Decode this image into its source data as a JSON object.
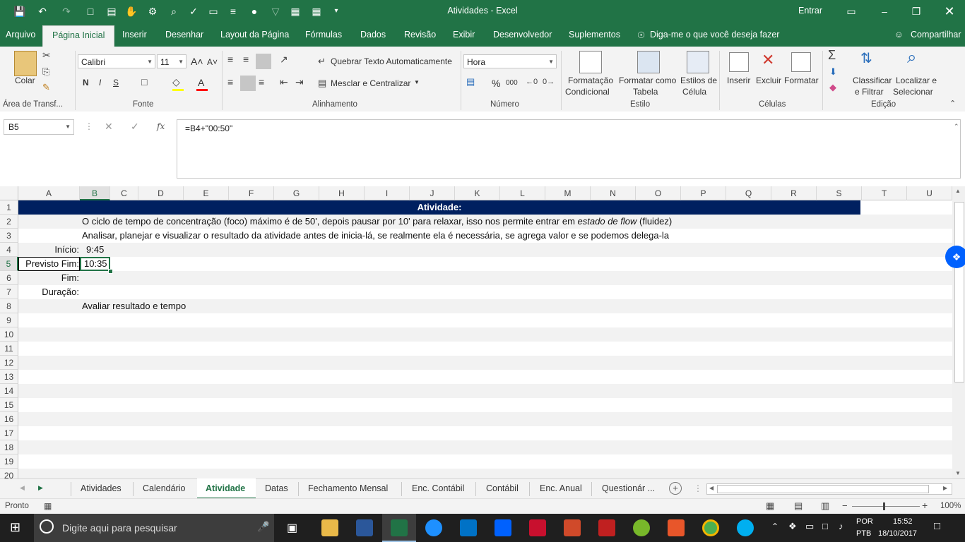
{
  "titlebar": {
    "title": "Atividades  -  Excel",
    "signin": "Entrar"
  },
  "ribbon_tabs": [
    "Arquivo",
    "Página Inicial",
    "Inserir",
    "Desenhar",
    "Layout da Página",
    "Fórmulas",
    "Dados",
    "Revisão",
    "Exibir",
    "Desenvolvedor",
    "Suplementos"
  ],
  "tell_me": "Diga-me o que você deseja fazer",
  "share": "Compartilhar",
  "ribbon": {
    "clipboard": {
      "paste": "Colar",
      "label": "Área de Transf..."
    },
    "font": {
      "name": "Calibri",
      "size": "11",
      "label": "Fonte",
      "bold": "N",
      "italic": "I",
      "underline": "S"
    },
    "alignment": {
      "wrap": "Quebrar Texto Automaticamente",
      "merge": "Mesclar e Centralizar",
      "label": "Alinhamento"
    },
    "number": {
      "format": "Hora",
      "label": "Número",
      "percent": "%",
      "thousands": "000"
    },
    "styles": {
      "conditional": [
        "Formatação",
        "Condicional"
      ],
      "table": [
        "Formatar como",
        "Tabela"
      ],
      "cell": [
        "Estilos de",
        "Célula"
      ],
      "label": "Estilo"
    },
    "cells": {
      "insert": "Inserir",
      "delete": "Excluir",
      "format": "Formatar",
      "label": "Células"
    },
    "editing": {
      "sort": [
        "Classificar",
        "e Filtrar"
      ],
      "find": [
        "Localizar e",
        "Selecionar"
      ],
      "label": "Edição"
    }
  },
  "formula_bar": {
    "name_box": "B5",
    "fx": "fx",
    "formula": "=B4+\"00:50\""
  },
  "columns": [
    "A",
    "B",
    "C",
    "D",
    "E",
    "F",
    "G",
    "H",
    "I",
    "J",
    "K",
    "L",
    "M",
    "N",
    "O",
    "P",
    "Q",
    "R",
    "S",
    "T",
    "U"
  ],
  "rows": [
    "1",
    "2",
    "3",
    "4",
    "5",
    "6",
    "7",
    "8",
    "9",
    "10",
    "11",
    "12",
    "13",
    "14",
    "15",
    "16",
    "17",
    "18",
    "19",
    "20"
  ],
  "cells": {
    "r1_title": "Atividade:",
    "r2_text_a": "O ciclo de tempo de concentração (foco) máximo é de 50', depois pausar por 10' para relaxar, isso nos permite entrar em ",
    "r2_text_b": "estado de flow",
    "r2_text_c": "  (fluidez)",
    "r3_text": "Analisar, planejar e visualizar o resultado da atividade antes de inicia-lá, se realmente ela é necessária, se agrega valor e se podemos delega-la",
    "r4_label": "Início:",
    "r4_value": "9:45",
    "r5_label": "Previsto Fim:",
    "r5_value": "10:35",
    "r6_label": "Fim:",
    "r7_label": "Duração:",
    "r8_text": "Avaliar resultado e tempo"
  },
  "sheet_tabs": [
    "Atividades",
    "Calendário",
    "Atividade",
    "Datas",
    "Fechamento Mensal",
    "Enc. Contábil",
    "Contábil",
    "Enc. Anual",
    "Questionár ..."
  ],
  "active_sheet": "Atividade",
  "status": {
    "ready": "Pronto",
    "zoom": "100%"
  },
  "taskbar": {
    "search_placeholder": "Digite aqui para pesquisar",
    "lang1": "POR",
    "lang2": "PTB",
    "time": "15:52",
    "date": "18/10/2017"
  },
  "colors": {
    "excel_green": "#217346",
    "title_fill": "#002060",
    "band": "#f2f2f2"
  }
}
